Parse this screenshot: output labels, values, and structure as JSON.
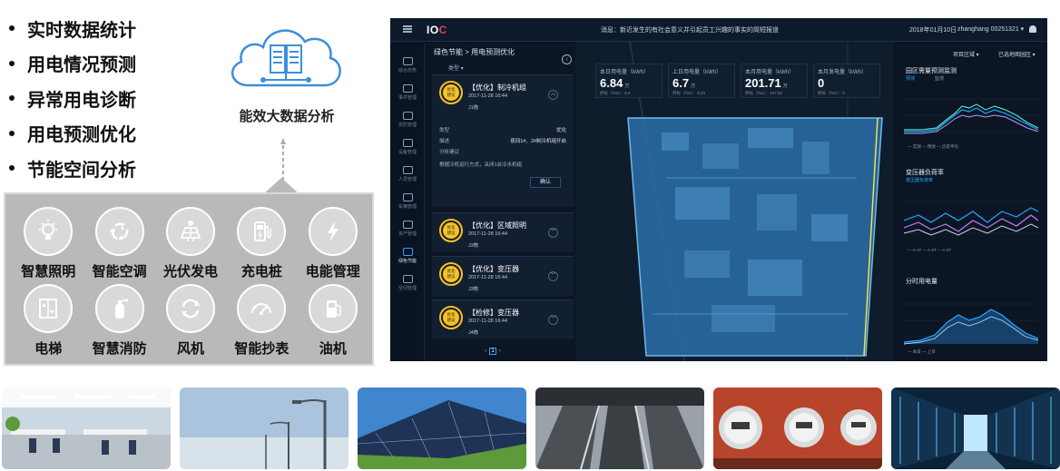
{
  "features": [
    "实时数据统计",
    "用电情况预测",
    "异常用电诊断",
    "用电预测优化",
    "节能空间分析"
  ],
  "cloud": {
    "caption": "能效大数据分析",
    "icon": "cloud-server-icon"
  },
  "apps": [
    {
      "label": "智慧照明",
      "icon": "lightbulb-icon"
    },
    {
      "label": "智能空调",
      "icon": "recycle-icon"
    },
    {
      "label": "光伏发电",
      "icon": "solar-panel-icon"
    },
    {
      "label": "充电桩",
      "icon": "charging-pile-icon"
    },
    {
      "label": "电能管理",
      "icon": "lightning-icon"
    },
    {
      "label": "电梯",
      "icon": "elevator-icon"
    },
    {
      "label": "智慧消防",
      "icon": "fire-extinguisher-icon"
    },
    {
      "label": "风机",
      "icon": "fan-icon"
    },
    {
      "label": "智能抄表",
      "icon": "meter-icon"
    },
    {
      "label": "油机",
      "icon": "fuel-pump-icon"
    }
  ],
  "dashboard": {
    "logo": {
      "main": "IO",
      "accent": "C"
    },
    "notice": "消息：新近发生的有社会意义并引起员工兴趣的事实的简短报道",
    "date": "2018年01月10日",
    "user": "zhanghang 00251321 ▾",
    "nav": [
      {
        "label": "综合态势",
        "active": false
      },
      {
        "label": "事件管理",
        "active": false
      },
      {
        "label": "安防管理",
        "active": false
      },
      {
        "label": "设备管理",
        "active": false
      },
      {
        "label": "人员管理",
        "active": false
      },
      {
        "label": "车辆管理",
        "active": false
      },
      {
        "label": "资产管理",
        "active": false
      },
      {
        "label": "绿色节能",
        "active": true
      },
      {
        "label": "空间管理",
        "active": false
      }
    ],
    "breadcrumb": "绿色节能 > 用电预测优化",
    "collapse": "‹",
    "type_filter": "类型 ▾",
    "cards": [
      {
        "badge": "优化\n建议",
        "title": "【优化】制冷机组",
        "time": "2017-11-28 16:44",
        "building": "J1栋",
        "chevron": "︿"
      },
      {
        "badge": "优化\n建议",
        "title": "【优化】区域照明",
        "time": "2017-11-28 16:44",
        "building": "J3栋",
        "chevron": "﹀"
      },
      {
        "badge": "优化\n建议",
        "title": "【优化】变压器",
        "time": "2017-11-28 16:44",
        "building": "J3栋",
        "chevron": "﹀"
      },
      {
        "badge": "优化\n建议",
        "title": "【检修】变压器",
        "time": "2017-11-28 16:44",
        "building": "J4栋",
        "chevron": "﹀"
      }
    ],
    "detail": {
      "type_label": "类型",
      "type_value": "优化",
      "desc_label": "描述",
      "desc_value": "夜间1#、2#制冷机组开启",
      "suggest_label": "分析建议",
      "suggest_value": "根据冷机运行方式，关闭1台冷水机组",
      "confirm": "确认"
    },
    "pager": {
      "prev": "‹",
      "page": "1",
      "next": "›"
    },
    "stats": [
      {
        "label": "本日用电量（kWh）",
        "value": "6.84",
        "unit": "万",
        "sub": "折标（Tce）：8.4"
      },
      {
        "label": "上日用电量（kWh）",
        "value": "6.7",
        "unit": "万",
        "sub": "折标（Tce）：8.23"
      },
      {
        "label": "本月用电量（kWh）",
        "value": "201.71",
        "unit": "万",
        "sub": "折标（Tce）：247.52"
      },
      {
        "label": "本月发电量（kWh）",
        "value": "0",
        "unit": "",
        "sub": "折标（Tce）：0"
      }
    ],
    "right": {
      "campus": "项目区域 ▾",
      "mode": "已选地图园区 ▾",
      "panel1_title": "园区需量预测监测",
      "panel1_tabs": [
        "预测",
        "监测"
      ],
      "panel1_legend": [
        "— 实测",
        "— 预测",
        "— 历史平均"
      ],
      "panel2_title": "变压器负荷率",
      "panel2_sub": "变压器负荷率",
      "panel2_legend": [
        "— A-1T",
        "— A-2T",
        "— A-3T"
      ],
      "panel3_title": "分时用电量",
      "panel3_legend": [
        "— 本日",
        "— 上日"
      ],
      "x_ticks": [
        "00",
        "02",
        "04",
        "06",
        "08",
        "10",
        "12",
        "14",
        "16",
        "18",
        "20",
        "22"
      ]
    }
  },
  "colors": {
    "accent": "#29a8ff",
    "badge": "#f2c230",
    "panel": "#b9b9b9",
    "dashboard_bg": "#0b1524"
  }
}
